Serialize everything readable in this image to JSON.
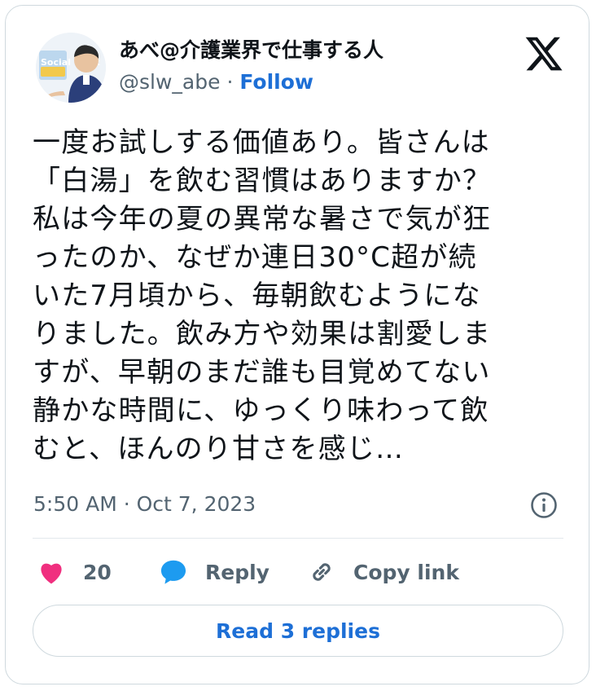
{
  "author": {
    "name": "あべ@介護業界で仕事する人",
    "handle": "@slw_abe",
    "separator": "·",
    "follow_label": "Follow",
    "avatar_text": "Social Work"
  },
  "tweet": {
    "text": "一度お試しする価値あり。皆さんは\n「白湯」を飲む習慣はありますか？\n私は今年の夏の異常な暑さで気が狂\nったのか、なぜか連日30°C超が続\nいた7月頃から、毎朝飲むようにな\nりました。飲み方や効果は割愛しま\nすが、早朝のまだ誰も目覚めてない\n静かな時間に、ゆっくり味わって飲\nむと、ほんのり甘さを感じ…",
    "timestamp": "5:50 AM · Oct 7, 2023"
  },
  "actions": {
    "like_count": "20",
    "reply_label": "Reply",
    "copy_label": "Copy link"
  },
  "read_replies_label": "Read 3 replies",
  "icons": [
    "x-logo-icon",
    "info-icon",
    "heart-icon",
    "reply-bubble-icon",
    "link-icon"
  ],
  "colors": {
    "accent": "#1d6fd6",
    "like": "#f02f7f",
    "reply": "#1d9bf0",
    "muted": "#536471",
    "border": "#cfd9de"
  }
}
